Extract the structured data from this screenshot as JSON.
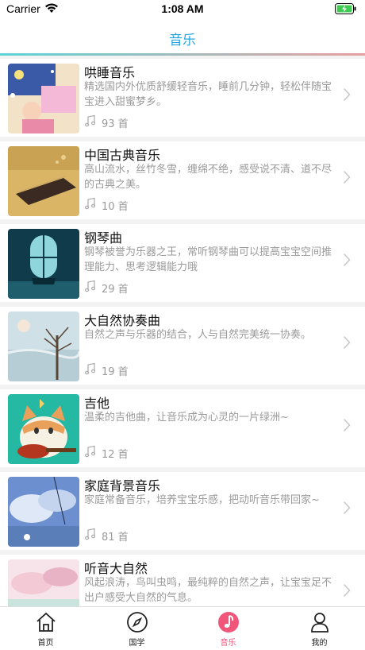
{
  "status": {
    "carrier": "Carrier",
    "time": "1:08 AM"
  },
  "nav": {
    "title": "音乐"
  },
  "items": [
    {
      "title": "哄睡音乐",
      "desc": "精选国内外优质舒缓轻音乐，睡前几分钟，轻松伴随宝宝进入甜蜜梦乡。",
      "count": "93 首"
    },
    {
      "title": "中国古典音乐",
      "desc": "高山流水，丝竹冬雪，缠绵不绝，感受说不清、道不尽的古典之美。",
      "count": "10 首"
    },
    {
      "title": "钢琴曲",
      "desc": "钢琴被誉为乐器之王，常听钢琴曲可以提高宝宝空间推理能力、思考逻辑能力哦",
      "count": "29 首"
    },
    {
      "title": "大自然协奏曲",
      "desc": "自然之声与乐器的结合，人与自然完美统一协奏。",
      "count": "19 首"
    },
    {
      "title": "吉他",
      "desc": "温柔的吉他曲，让音乐成为心灵的一片绿洲~",
      "count": "12 首"
    },
    {
      "title": "家庭背景音乐",
      "desc": "家庭常备音乐，培养宝宝乐感，把动听音乐带回家~",
      "count": "81 首"
    },
    {
      "title": "听音大自然",
      "desc": "风起浪涛，鸟叫虫鸣，最纯粹的自然之声，让宝宝足不出户感受大自然的气息。",
      "count": ""
    }
  ],
  "tabs": [
    {
      "label": "首页"
    },
    {
      "label": "国学"
    },
    {
      "label": "音乐"
    },
    {
      "label": "我的"
    }
  ],
  "colors": {
    "accent": "#29a6e0",
    "active_tab": "#f0567a",
    "inactive_tab": "#222222"
  }
}
